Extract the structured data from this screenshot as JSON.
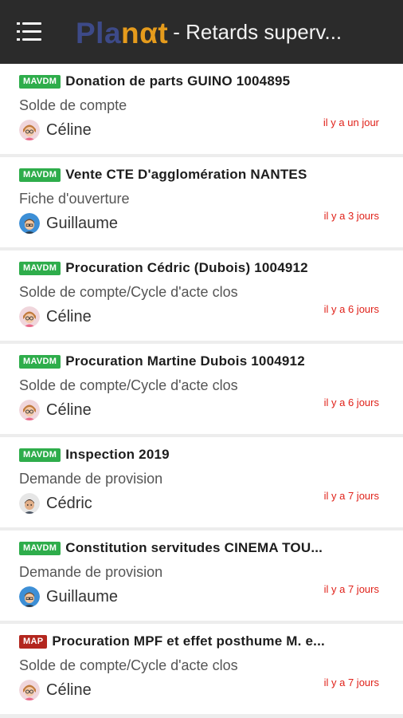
{
  "header": {
    "menu_icon": "menu-icon",
    "logo_part1": "Pla",
    "logo_part2": "nαt",
    "title": "- Retards superv..."
  },
  "colors": {
    "appbar": "#2b2b2b",
    "tag_mavdm": "#2ead4b",
    "tag_map": "#b3261e",
    "time": "#e0221a",
    "logo_blue": "#3d4a88",
    "logo_orange": "#e59b1c"
  },
  "items": [
    {
      "tag": "MAVDM",
      "title": "Donation de parts GUINO 1004895",
      "subtitle": "Solde de compte",
      "person": "Céline",
      "time": "il y a un jour"
    },
    {
      "tag": "MAVDM",
      "title": "Vente CTE D'agglomération NANTES",
      "subtitle": "Fiche d'ouverture",
      "person": "Guillaume",
      "time": "il y a 3 jours"
    },
    {
      "tag": "MAVDM",
      "title": "Procuration Cédric (Dubois) 1004912",
      "subtitle": "Solde de compte/Cycle d'acte clos",
      "person": "Céline",
      "time": "il y a 6 jours"
    },
    {
      "tag": "MAVDM",
      "title": "Procuration Martine Dubois 1004912",
      "subtitle": "Solde de compte/Cycle d'acte clos",
      "person": "Céline",
      "time": "il y a 6 jours"
    },
    {
      "tag": "MAVDM",
      "title": "Inspection 2019",
      "subtitle": "Demande de provision",
      "person": "Cédric",
      "time": "il y a 7 jours"
    },
    {
      "tag": "MAVDM",
      "title": "Constitution servitudes CINEMA TOU...",
      "subtitle": "Demande de provision",
      "person": "Guillaume",
      "time": "il y a 7 jours"
    },
    {
      "tag": "MAP",
      "title": "Procuration MPF et effet posthume M. e...",
      "subtitle": "Solde de compte/Cycle d'acte clos",
      "person": "Céline",
      "time": "il y a 7 jours"
    }
  ]
}
